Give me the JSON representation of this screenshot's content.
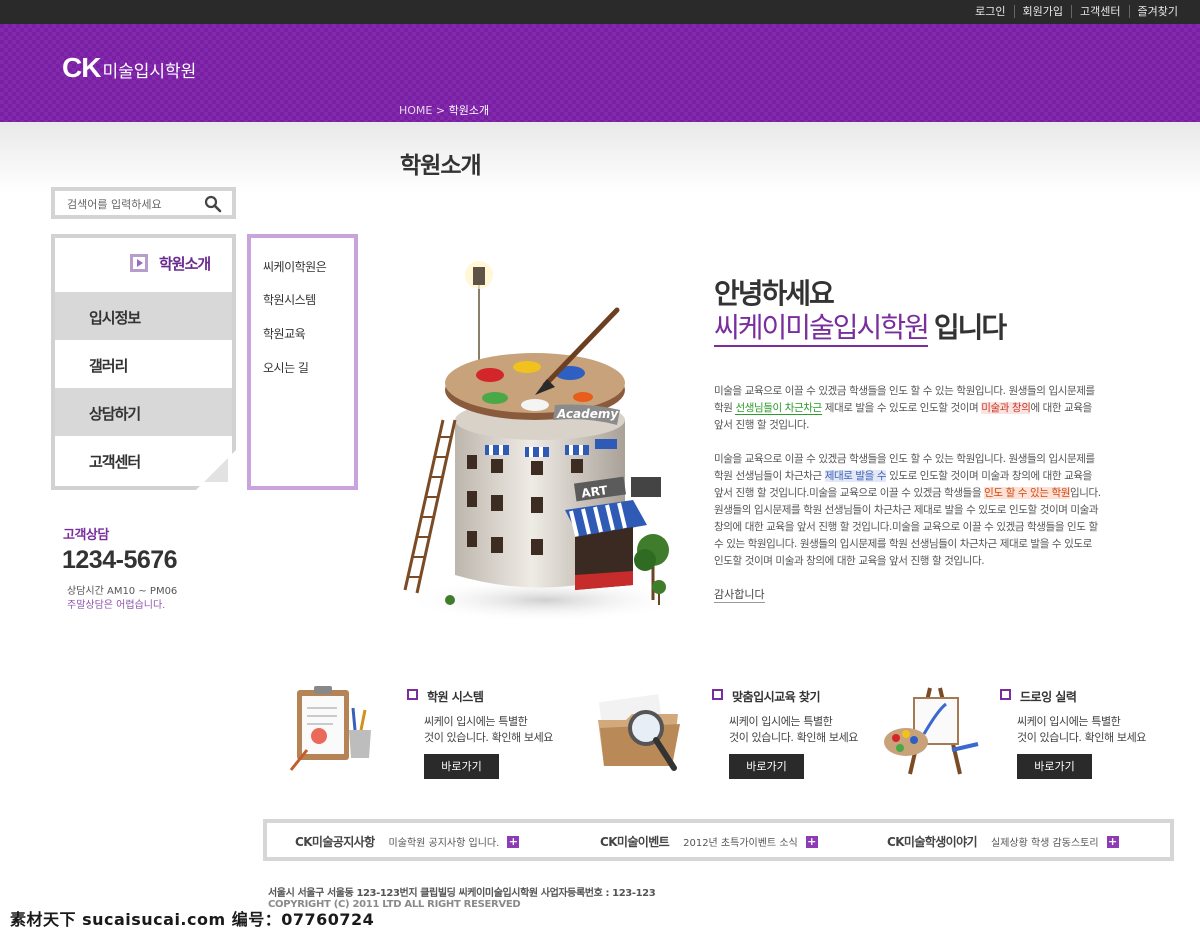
{
  "topbar": {
    "links": [
      "로그인",
      "회원가입",
      "고객센터",
      "즐겨찾기"
    ]
  },
  "header": {
    "logo_ck": "CK",
    "logo_name": "미술입시학원",
    "breadcrumb_home": "HOME",
    "breadcrumb_sep": ">",
    "breadcrumb_current": "학원소개"
  },
  "page_title": "학원소개",
  "search": {
    "placeholder": "검색어를 입력하세요"
  },
  "left_menu": {
    "items": [
      "학원소개",
      "입시정보",
      "갤러리",
      "상담하기",
      "고객센터"
    ],
    "active": "학원소개"
  },
  "sub_menu": {
    "items": [
      "씨케이학원은",
      "학원시스템",
      "학원교육",
      "오시는 길"
    ]
  },
  "consult": {
    "title": "고객상담",
    "phone": "1234-5676",
    "hours": "상담시간  AM10 ~ PM06",
    "weekend": "주말상담은 어렵습니다."
  },
  "illustration": {
    "academy_label": "Academy",
    "art_label": "ART"
  },
  "greeting": {
    "line1": "안녕하세요",
    "line2_highlight": "씨케이미술입시학원",
    "line2_tail": "입니다",
    "p1": [
      "미술을 교육으로 이끌 수 있겠금 학생들을 인도 할 수 있는 학원입니다. 원생들의 입시문제를",
      "학원 ",
      "선생님들이 차근차근",
      " 제대로 발을 수 있도로 인도할 것이며 ",
      "미술과 창의",
      "에 대한 교육을",
      "앞서 진행 할 것입니다."
    ],
    "p2": [
      "미술을 교육으로 이끌 수 있겠금 학생들을 인도 할 수 있는 학원입니다. 원생들의 입시문제를",
      "학원 선생님들이 차근차근 ",
      "제대로 발을 수",
      " 있도로 인도할 것이며 미술과 창의에 대한 교육을",
      "앞서 진행 할 것입니다.미술을 교육으로 이끌 수 있겠금 학생들을 ",
      "인도 할 수 있는 학원",
      "입니다.",
      "원생들의 입시문제를 학원 선생님들이 차근차근 제대로 발을 수 있도로 인도할 것이며 미술과",
      "창의에 대한 교육을 앞서 진행 할 것입니다.미술을 교육으로 이끌 수 있겠금 학생들을 인도 할",
      "수 있는 학원입니다. 원생들의 입시문제를 학원 선생님들이 차근차근 제대로 발을 수 있도로",
      "인도할 것이며 미술과 창의에 대한 교육을 앞서 진행 할 것입니다."
    ],
    "thanks": "감사합니다"
  },
  "features": [
    {
      "title": "학원 시스템",
      "desc1": "씨케이 입시에는 특별한",
      "desc2": "것이 있습니다. 확인해 보세요",
      "button": "바로가기",
      "icon": "clipboard-icon"
    },
    {
      "title": "맞춤입시교육 찾기",
      "desc1": "씨케이 입시에는 특별한",
      "desc2": "것이 있습니다. 확인해 보세요",
      "button": "바로가기",
      "icon": "folder-magnifier-icon"
    },
    {
      "title": "드로잉 실력",
      "desc1": "씨케이 입시에는 특별한",
      "desc2": "것이 있습니다. 확인해 보세요",
      "button": "바로가기",
      "icon": "easel-icon"
    }
  ],
  "notice_bar": [
    {
      "title": "CK미술공지사항",
      "desc": "미술학원 공지사항 입니다."
    },
    {
      "title": "CK미술이벤트",
      "desc": "2012년 초특가이벤트 소식"
    },
    {
      "title": "CK미술학생이야기",
      "desc": "실제상황 학생 감동스토리"
    }
  ],
  "footer": {
    "address": "서울시 서울구 서울동 123-123번지 클립빌딩 씨케이미술입시학원 사업자등록번호 : 123-123",
    "copyright": "COPYRIGHT (C) 2011 LTD ALL RIGHT RESERVED"
  },
  "watermark": {
    "text": "素材天下 sucaisucai.com   编号：07760724"
  },
  "colors": {
    "brand_purple": "#7a1fa5",
    "accent_purple": "#7a2d9e",
    "topbar": "#2a2a2a"
  }
}
